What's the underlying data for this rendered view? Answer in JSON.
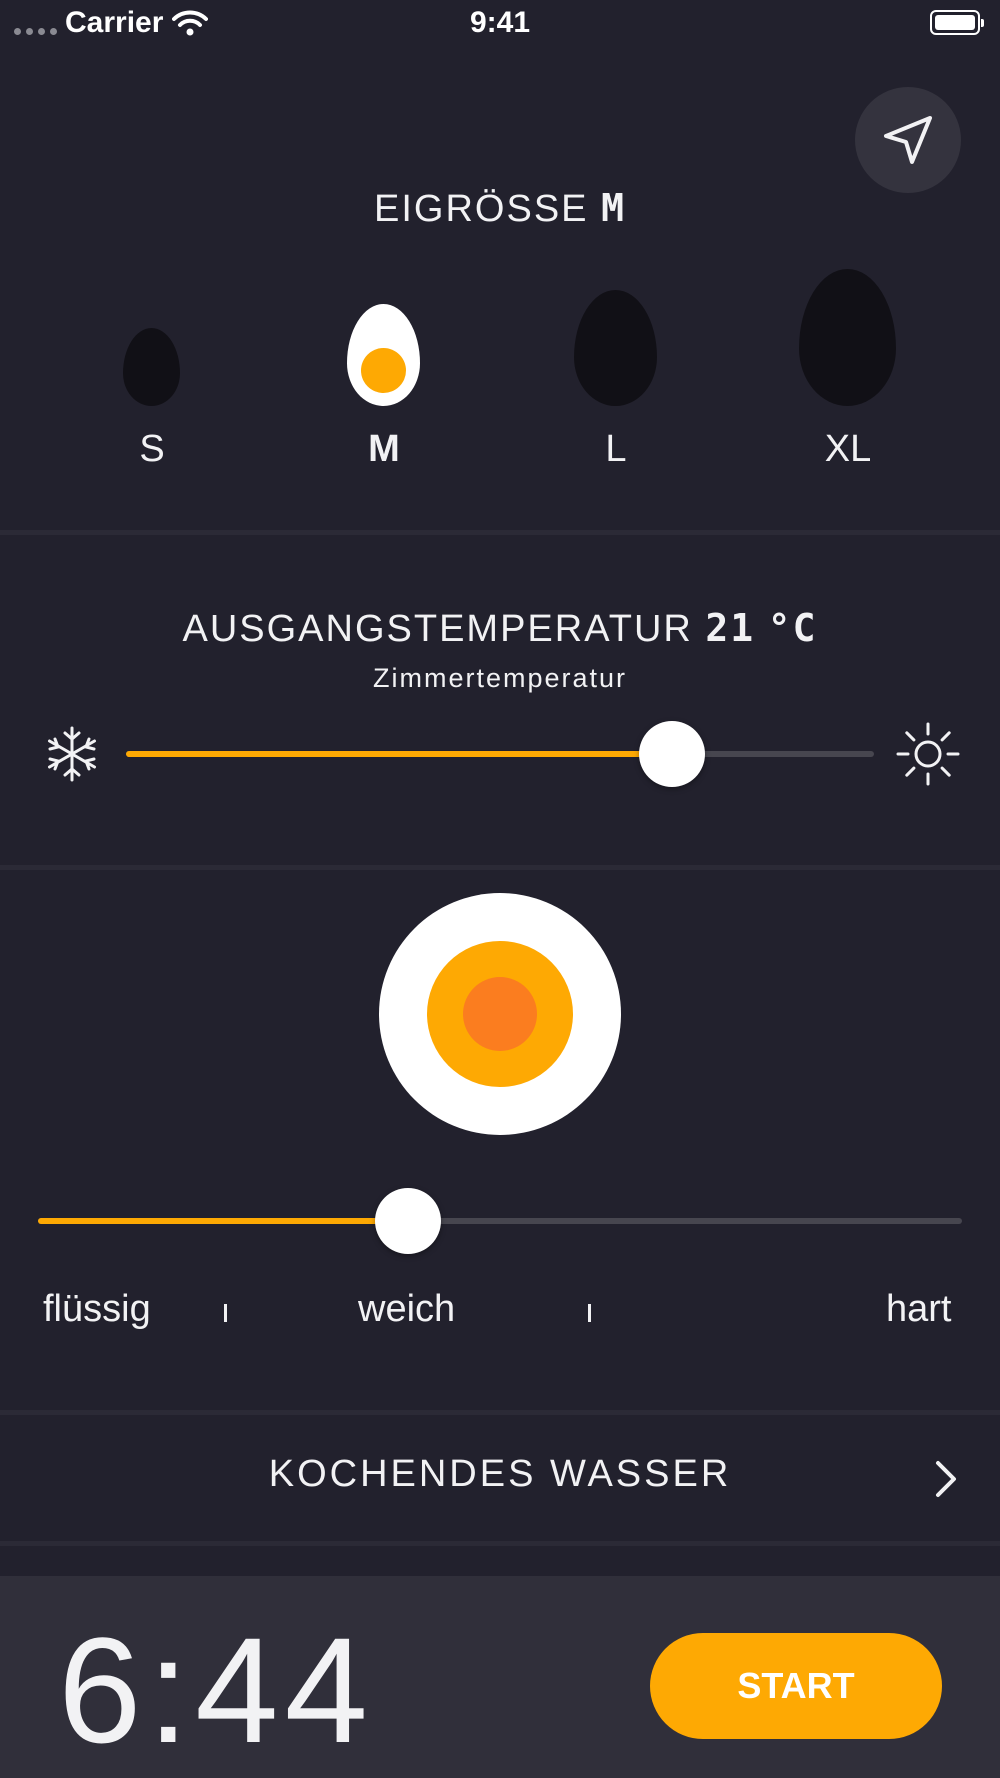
{
  "status_bar": {
    "carrier": "Carrier",
    "time": "9:41"
  },
  "icons": {
    "location": "location-arrow-icon",
    "cold": "snowflake-icon",
    "warm": "sun-icon",
    "chevron": "chevron-right-icon"
  },
  "egg_size": {
    "title": "EIGRÖSSE",
    "selected": "M",
    "options": [
      "S",
      "M",
      "L",
      "XL"
    ]
  },
  "start_temperature": {
    "title": "AUSGANGSTEMPERATUR",
    "value": "21",
    "unit": "°C",
    "description": "Zimmertemperatur",
    "slider_fraction": 0.73
  },
  "hardness": {
    "slider_fraction": 0.4,
    "labels": [
      "flüssig",
      "weich",
      "hart"
    ]
  },
  "water": {
    "label": "KOCHENDES WASSER"
  },
  "footer": {
    "timer": "6:44",
    "start_label": "START"
  },
  "colors": {
    "background": "#22212d",
    "accent": "#fea903",
    "yolk_core": "#fb7d1f",
    "egg_inactive": "#111016",
    "footer": "#302f3a"
  }
}
